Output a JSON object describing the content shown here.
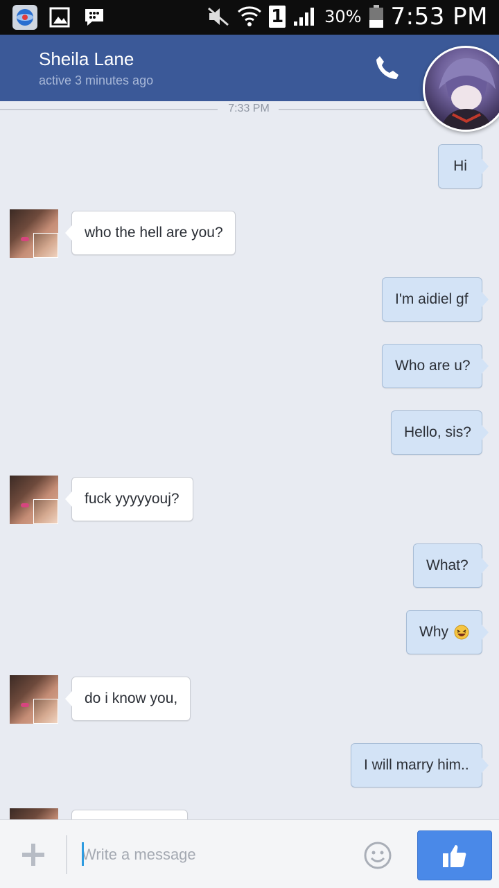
{
  "status_bar": {
    "left_icons": [
      "browser-icon",
      "gallery-icon",
      "bbm-icon"
    ],
    "battery_percent": "30%",
    "time": "7:53 PM",
    "sim_badge": "1"
  },
  "header": {
    "name": "Sheila Lane",
    "status": "active 3 minutes ago"
  },
  "thread": {
    "time_divider": "7:33 PM",
    "messages": [
      {
        "dir": "out",
        "text": "Hi"
      },
      {
        "dir": "in",
        "text": "who the hell are you?"
      },
      {
        "dir": "out",
        "text": "I'm aidiel gf"
      },
      {
        "dir": "out",
        "text": "Who are u?"
      },
      {
        "dir": "out",
        "text": "Hello, sis?"
      },
      {
        "dir": "in",
        "text": "fuck yyyyyouj?"
      },
      {
        "dir": "out",
        "text": "What?"
      },
      {
        "dir": "out",
        "text": "Why",
        "emoji": "laughing-emoji"
      },
      {
        "dir": "in",
        "text": "do i know you,"
      },
      {
        "dir": "out",
        "text": "I will marry him.."
      }
    ]
  },
  "composer": {
    "placeholder": "Write a message",
    "value": ""
  },
  "colors": {
    "header_bg": "#3b5998",
    "outgoing_bubble": "#d3e3f6",
    "incoming_bubble": "#ffffff",
    "send_button": "#4a89e8"
  }
}
